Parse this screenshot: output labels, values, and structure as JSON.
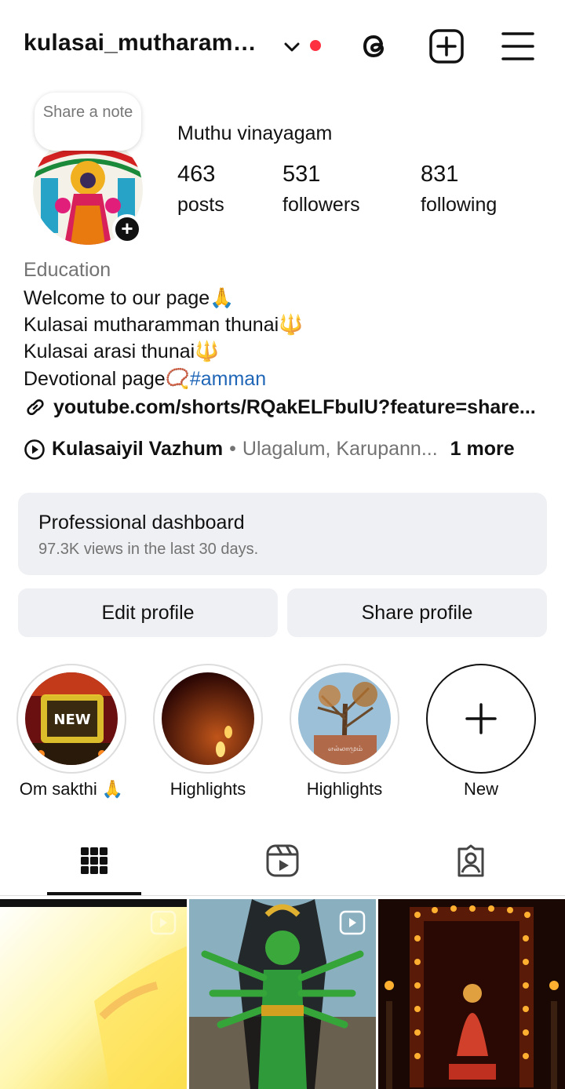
{
  "header": {
    "username": "kulasai_mutharamm...",
    "icons": [
      "chevron-down-icon",
      "threads-icon",
      "new-post-icon",
      "menu-icon"
    ],
    "notification_color": "#ff3040"
  },
  "note": {
    "placeholder": "Share a note"
  },
  "profile": {
    "full_name": "Muthu vinayagam",
    "stats": [
      {
        "value": "463",
        "label": "posts"
      },
      {
        "value": "531",
        "label": "followers"
      },
      {
        "value": "831",
        "label": "following"
      }
    ],
    "category": "Education",
    "bio": {
      "line1": "Welcome to our page🙏",
      "line2": "Kulasai mutharamman thunai🔱",
      "line3": "Kulasai arasi thunai🔱",
      "line4_text": "Devotional page📿",
      "line4_hashtag": "#amman"
    },
    "link": "youtube.com/shorts/RQakELFbulU?feature=share...",
    "music": {
      "title": "Kulasaiyil Vazhum",
      "separator": "•",
      "artist": "Ulagalum, Karupann...",
      "more": "1 more"
    }
  },
  "dashboard": {
    "title": "Professional dashboard",
    "subtitle": "97.3K views in the last 30 days."
  },
  "buttons": {
    "edit": "Edit profile",
    "share": "Share profile"
  },
  "highlights": [
    {
      "label": "Om sakthi 🙏",
      "thumb_text": "NEW"
    },
    {
      "label": "Highlights"
    },
    {
      "label": "Highlights",
      "thumb_text": "எல்லாமும்"
    },
    {
      "label": "New"
    }
  ],
  "tabs": [
    "grid-icon",
    "reels-icon",
    "tagged-icon"
  ],
  "colors": {
    "accent_link": "#1f66b7",
    "panel_bg": "#eff0f3",
    "muted_text": "#737373"
  }
}
